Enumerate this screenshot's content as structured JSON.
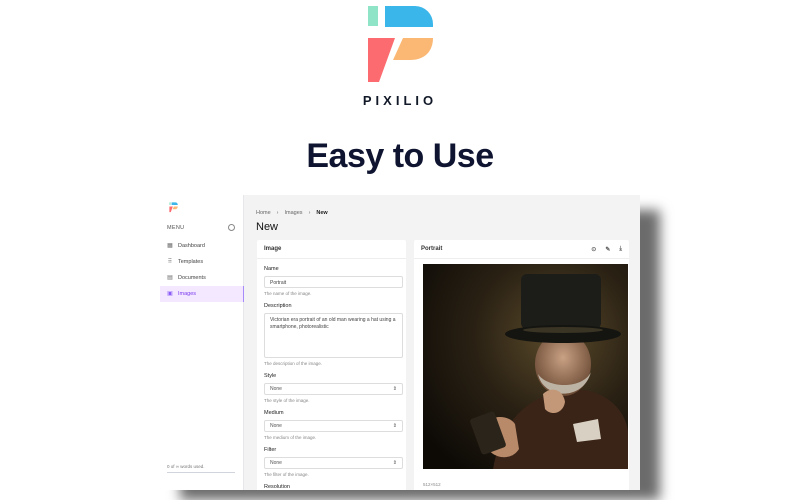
{
  "brand": {
    "name": "PIXILIO",
    "colors": {
      "mint": "#8fe3c6",
      "blue": "#3bb6ea",
      "coral": "#fb6b70",
      "peach": "#fbb874"
    }
  },
  "hero": {
    "title": "Easy to Use"
  },
  "app": {
    "sidebar": {
      "menu_label": "MENU",
      "items": [
        {
          "label": "Dashboard",
          "icon": "dashboard-icon",
          "active": false
        },
        {
          "label": "Templates",
          "icon": "templates-icon",
          "active": false
        },
        {
          "label": "Documents",
          "icon": "documents-icon",
          "active": false
        },
        {
          "label": "Images",
          "icon": "images-icon",
          "active": true
        }
      ],
      "usage_text": "0 of ∞ words used."
    },
    "breadcrumb": [
      "Home",
      "Images",
      "New"
    ],
    "page_title": "New",
    "form_card": {
      "title": "Image",
      "fields": {
        "name": {
          "label": "Name",
          "value": "Portrait",
          "help": "The name of the image."
        },
        "description": {
          "label": "Description",
          "value": "Victorian era portrait of an old man wearing a hat using a smartphone, photorealistic",
          "help": "The description of the image."
        },
        "style": {
          "label": "Style",
          "value": "None",
          "help": "The style of the image."
        },
        "medium": {
          "label": "Medium",
          "value": "None",
          "help": "The medium of the image."
        },
        "filter": {
          "label": "Filter",
          "value": "None",
          "help": "The filter of the image."
        },
        "resolution": {
          "label": "Resolution"
        }
      }
    },
    "image_card": {
      "title": "Portrait",
      "actions": [
        "view-icon",
        "edit-icon",
        "download-icon"
      ],
      "resolution": "512×512"
    }
  }
}
